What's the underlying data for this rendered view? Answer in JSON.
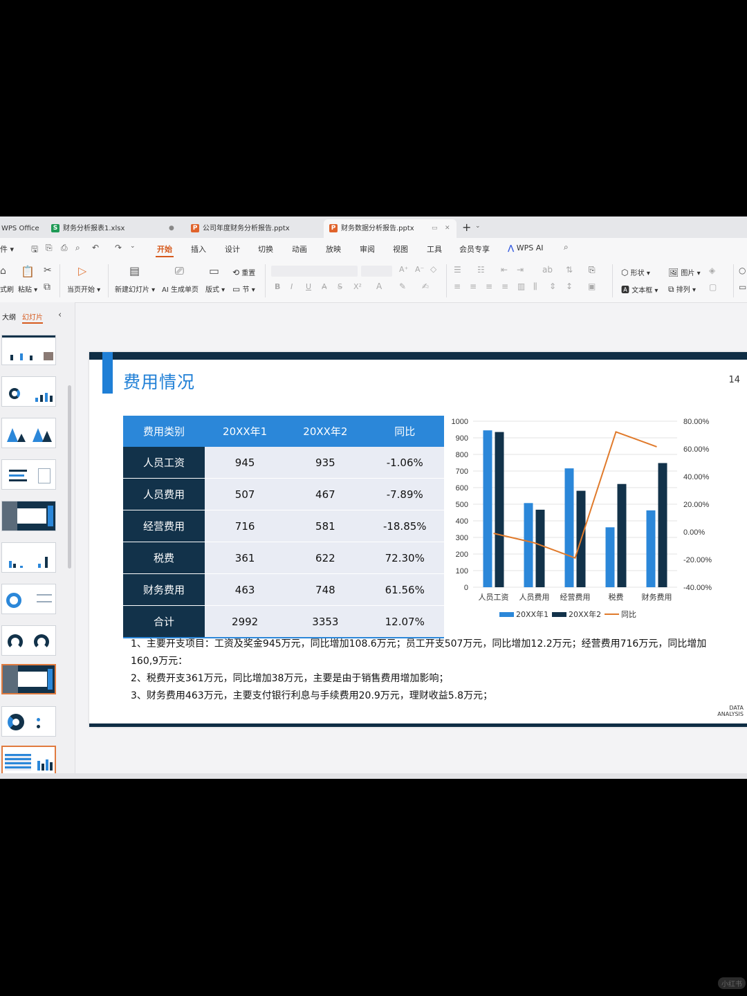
{
  "tabs": [
    {
      "label": "WPS Office"
    },
    {
      "label": "财务分析报表1.xlsx",
      "badge": "S"
    },
    {
      "label": "公司年度财务分析报告.pptx",
      "badge": "P"
    },
    {
      "label": "财务数据分析报告.pptx",
      "badge": "P"
    }
  ],
  "menu": {
    "file": "件",
    "items": [
      "开始",
      "插入",
      "设计",
      "切换",
      "动画",
      "放映",
      "审阅",
      "视图",
      "工具",
      "会员专享"
    ],
    "wps_ai": "WPS AI"
  },
  "ribbon": {
    "format_painter": "式刷",
    "paste": "粘贴",
    "play_from_current": "当页开始",
    "new_slide": "新建幻灯片",
    "ai_page": "AI 生成单页",
    "layout": "版式",
    "reset": "重置",
    "section": "节",
    "shape": "形状",
    "picture": "图片",
    "textbox": "文本框",
    "arrange": "排列"
  },
  "left_panel": {
    "tab_outline": "大纲",
    "tab_slides": "幻灯片"
  },
  "slide": {
    "title": "费用情况",
    "page_number": "14",
    "brand_line1": "DATA",
    "brand_line2": "ANALYSIS",
    "table": {
      "headers": [
        "费用类别",
        "20XX年1",
        "20XX年2",
        "同比"
      ],
      "rows": [
        [
          "人员工资",
          "945",
          "935",
          "-1.06%"
        ],
        [
          "人员费用",
          "507",
          "467",
          "-7.89%"
        ],
        [
          "经营费用",
          "716",
          "581",
          "-18.85%"
        ],
        [
          "税费",
          "361",
          "622",
          "72.30%"
        ],
        [
          "财务费用",
          "463",
          "748",
          "61.56%"
        ],
        [
          "合计",
          "2992",
          "3353",
          "12.07%"
        ]
      ]
    },
    "notes": [
      "1、主要开支项目：工资及奖金945万元，同比增加108.6万元；员工开支507万元，同比增加12.2万元；经营费用716万元，同比增加160,9万元：",
      "2、税费开支361万元，同比增加38万元，主要是由于销售费用增加影响；",
      "3、财务费用463万元，主要支付银行利息与手续费用20.9万元，理财收益5.8万元；"
    ]
  },
  "chart_data": {
    "type": "bar",
    "categories": [
      "人员工资",
      "人员费用",
      "经营费用",
      "税费",
      "财务费用"
    ],
    "series": [
      {
        "name": "20XX年1",
        "type": "bar",
        "axis": "left",
        "color": "#2b87d9",
        "values": [
          945,
          507,
          716,
          361,
          463
        ]
      },
      {
        "name": "20XX年2",
        "type": "bar",
        "axis": "left",
        "color": "#12324a",
        "values": [
          935,
          467,
          581,
          622,
          748
        ]
      },
      {
        "name": "同比",
        "type": "line",
        "axis": "right",
        "color": "#e07a2b",
        "values": [
          -1.06,
          -7.89,
          -18.85,
          72.3,
          61.56
        ]
      }
    ],
    "ylim": [
      0,
      1000
    ],
    "yticks": [
      "0",
      "100",
      "200",
      "300",
      "400",
      "500",
      "600",
      "700",
      "800",
      "900",
      "1000"
    ],
    "y2lim": [
      -40,
      80
    ],
    "y2ticks": [
      "-40.00%",
      "-20.00%",
      "0.00%",
      "20.00%",
      "40.00%",
      "60.00%",
      "80.00%"
    ],
    "grid": true,
    "legend": "bottom"
  },
  "watermark": "小红书"
}
